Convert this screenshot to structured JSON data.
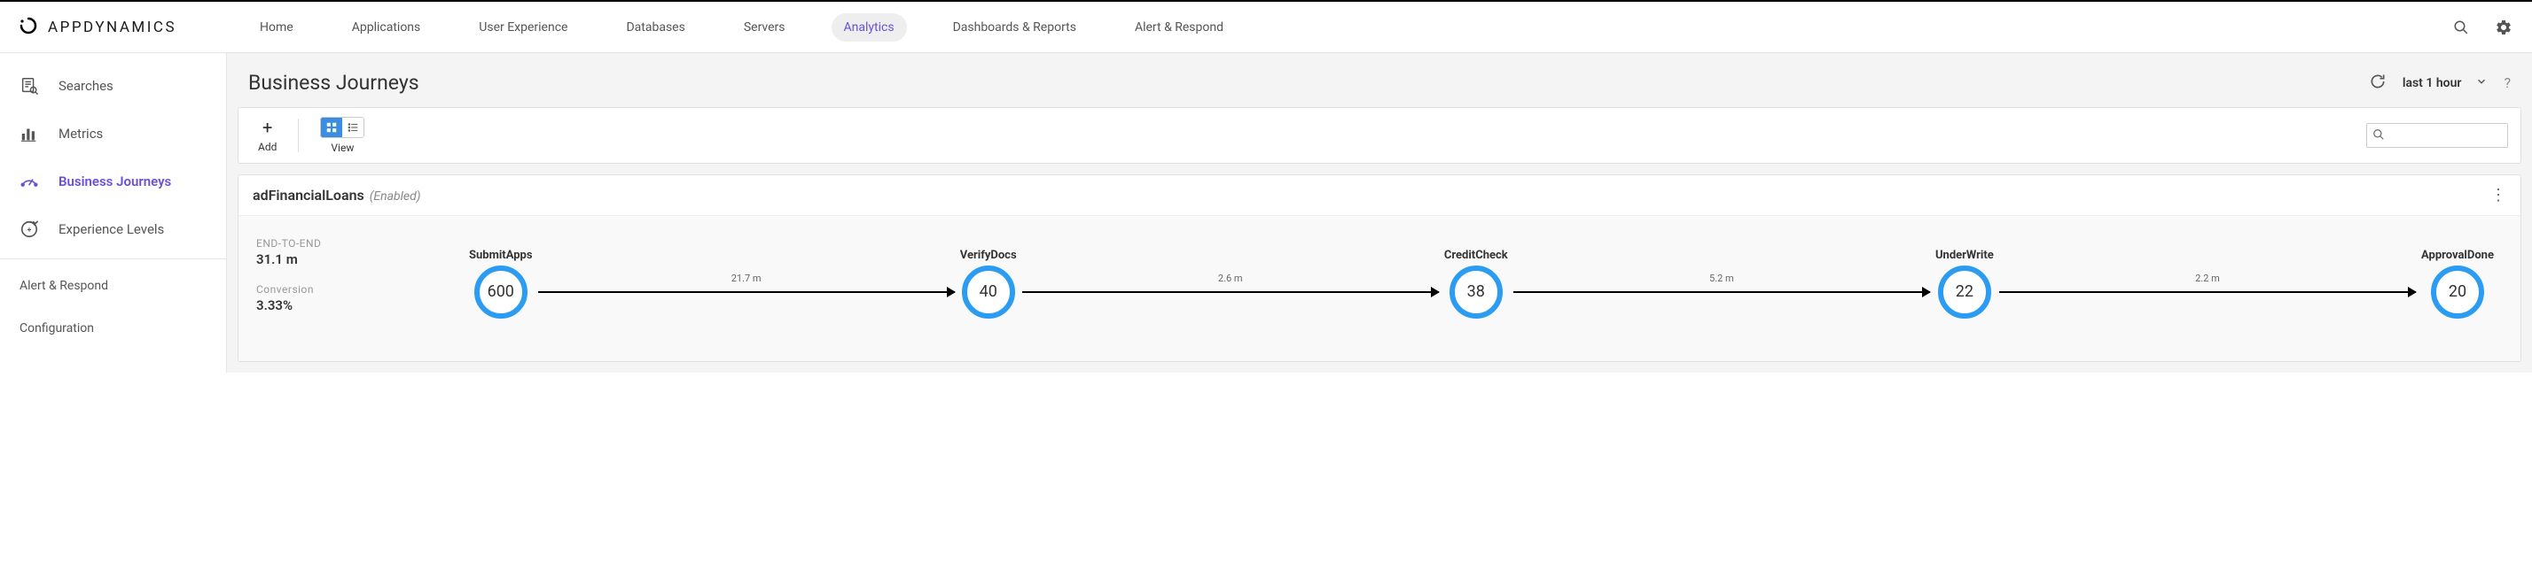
{
  "brand": {
    "name": "APPDYNAMICS"
  },
  "topnav": {
    "items": [
      {
        "label": "Home"
      },
      {
        "label": "Applications"
      },
      {
        "label": "User Experience"
      },
      {
        "label": "Databases"
      },
      {
        "label": "Servers"
      },
      {
        "label": "Analytics",
        "active": true
      },
      {
        "label": "Dashboards & Reports"
      },
      {
        "label": "Alert & Respond"
      }
    ]
  },
  "sidebar": {
    "items": [
      {
        "label": "Searches",
        "icon": "search-doc"
      },
      {
        "label": "Metrics",
        "icon": "bars"
      },
      {
        "label": "Business Journeys",
        "icon": "gauge",
        "active": true
      },
      {
        "label": "Experience Levels",
        "icon": "xp"
      }
    ],
    "lower": [
      {
        "label": "Alert & Respond"
      },
      {
        "label": "Configuration"
      }
    ]
  },
  "page": {
    "title": "Business Journeys",
    "time_range": "last 1 hour"
  },
  "toolbar": {
    "add_label": "Add",
    "view_label": "View",
    "search_placeholder": ""
  },
  "journey": {
    "name": "adFinancialLoans",
    "status": "(Enabled)",
    "stats": {
      "end_to_end_label": "END-TO-END",
      "end_to_end_value": "31.1 m",
      "conversion_label": "Conversion",
      "conversion_value": "3.33%"
    },
    "nodes": [
      {
        "label": "SubmitApps",
        "value": "600"
      },
      {
        "label": "VerifyDocs",
        "value": "40"
      },
      {
        "label": "CreditCheck",
        "value": "38"
      },
      {
        "label": "UnderWrite",
        "value": "22"
      },
      {
        "label": "ApprovalDone",
        "value": "20"
      }
    ],
    "edges": [
      {
        "label": "21.7 m"
      },
      {
        "label": "2.6 m"
      },
      {
        "label": "5.2 m"
      },
      {
        "label": "2.2 m"
      }
    ]
  },
  "chart_data": {
    "type": "funnel",
    "title": "adFinancialLoans Business Journey",
    "categories": [
      "SubmitApps",
      "VerifyDocs",
      "CreditCheck",
      "UnderWrite",
      "ApprovalDone"
    ],
    "values": [
      600,
      40,
      38,
      22,
      20
    ],
    "transition_times_minutes": [
      21.7,
      2.6,
      5.2,
      2.2
    ],
    "end_to_end_minutes": 31.1,
    "conversion_pct": 3.33
  }
}
